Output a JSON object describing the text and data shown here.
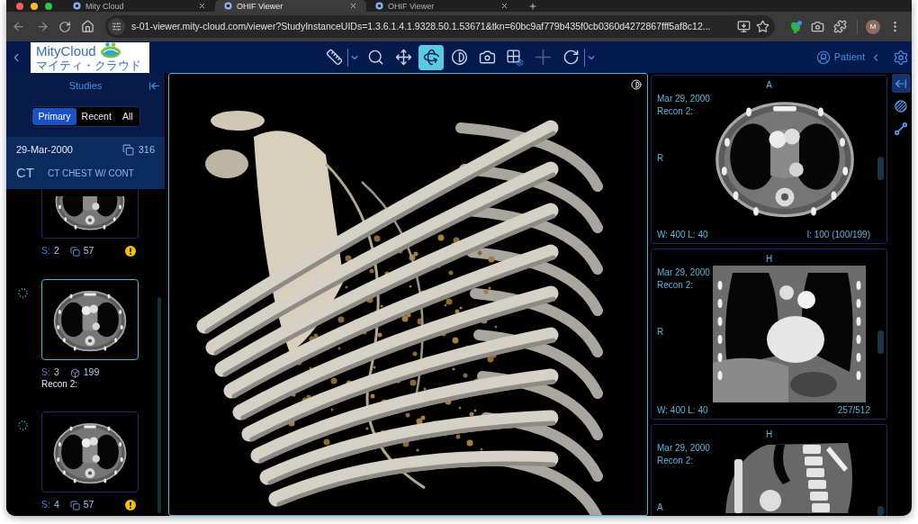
{
  "browser": {
    "tabs": [
      {
        "title": "Mity Cloud",
        "selected": false
      },
      {
        "title": "OHIF Viewer",
        "selected": true
      },
      {
        "title": "OHIF Viewer",
        "selected": false
      }
    ],
    "address_bar": {
      "url": "s-01-viewer.mity-cloud.com/viewer?StudyInstanceUIDs=1.3.6.1.4.1.9328.50.1.53671&tkn=60bc9af779b435f0cb0360d4272867fff5af8c12..."
    },
    "profile": {
      "initial": "M"
    }
  },
  "header": {
    "logo": {
      "name": "MityCloud",
      "tagline": "マイティ・クラウド"
    },
    "tools": [
      {
        "kind": "measure",
        "selected": false,
        "disabled": false,
        "dropdown": true
      },
      {
        "kind": "zoom",
        "selected": false,
        "disabled": false,
        "dropdown": false
      },
      {
        "kind": "pan",
        "selected": false,
        "disabled": false,
        "dropdown": false
      },
      {
        "kind": "rotate3d",
        "selected": true,
        "disabled": false,
        "dropdown": false
      },
      {
        "kind": "window_level",
        "selected": false,
        "disabled": false,
        "dropdown": false
      },
      {
        "kind": "capture",
        "selected": false,
        "disabled": false,
        "dropdown": false
      },
      {
        "kind": "layout",
        "selected": false,
        "disabled": false,
        "dropdown": false
      },
      {
        "kind": "crosshairs",
        "selected": false,
        "disabled": true,
        "dropdown": false
      },
      {
        "kind": "reset",
        "selected": false,
        "disabled": false,
        "dropdown": true
      }
    ],
    "patient": {
      "label": "Patient"
    }
  },
  "studies_panel": {
    "title": "Studies",
    "filters": [
      {
        "label": "Primary",
        "selected": true
      },
      {
        "label": "Recent",
        "selected": false
      },
      {
        "label": "All",
        "selected": false
      }
    ],
    "study": {
      "date": "29-Mar-2000",
      "instance_count": "316",
      "modality": "CT",
      "description": "CT CHEST W/ CONT"
    },
    "series": [
      {
        "kind": "stack",
        "series_label": "S:",
        "series_number": "2",
        "count": "57",
        "warning": true,
        "selected": false,
        "loading": false
      },
      {
        "kind": "volume",
        "series_label": "S:",
        "series_number": "3",
        "count": "199",
        "description": "Recon 2:",
        "warning": false,
        "selected": true,
        "loading": true
      },
      {
        "kind": "stack",
        "series_label": "S:",
        "series_number": "4",
        "count": "57",
        "warning": true,
        "selected": false,
        "loading": true
      }
    ]
  },
  "viewports": {
    "main": {
      "kind": "volume",
      "selected": true
    },
    "side": [
      {
        "kind": "axial",
        "selected": false,
        "date": "Mar 29, 2000",
        "description": "Recon 2:",
        "top_marker": "A",
        "left_marker": "R",
        "window_level": "W: 400 L: 40",
        "position": "I: 100 (100/199)"
      },
      {
        "kind": "coronal",
        "selected": false,
        "date": "Mar 29, 2000",
        "description": "Recon 2:",
        "top_marker": "H",
        "left_marker": "R",
        "window_level": "W: 400 L: 40",
        "position": "257/512"
      },
      {
        "kind": "sagittal",
        "selected": false,
        "date": "Mar 29, 2000",
        "description": "Recon 2:",
        "top_marker": "H",
        "left_marker": "A"
      }
    ]
  },
  "right_toolbar": [
    {
      "kind": "panel_toggle",
      "selected": true
    },
    {
      "kind": "segmentation",
      "selected": false
    },
    {
      "kind": "measurement",
      "selected": false
    }
  ]
}
